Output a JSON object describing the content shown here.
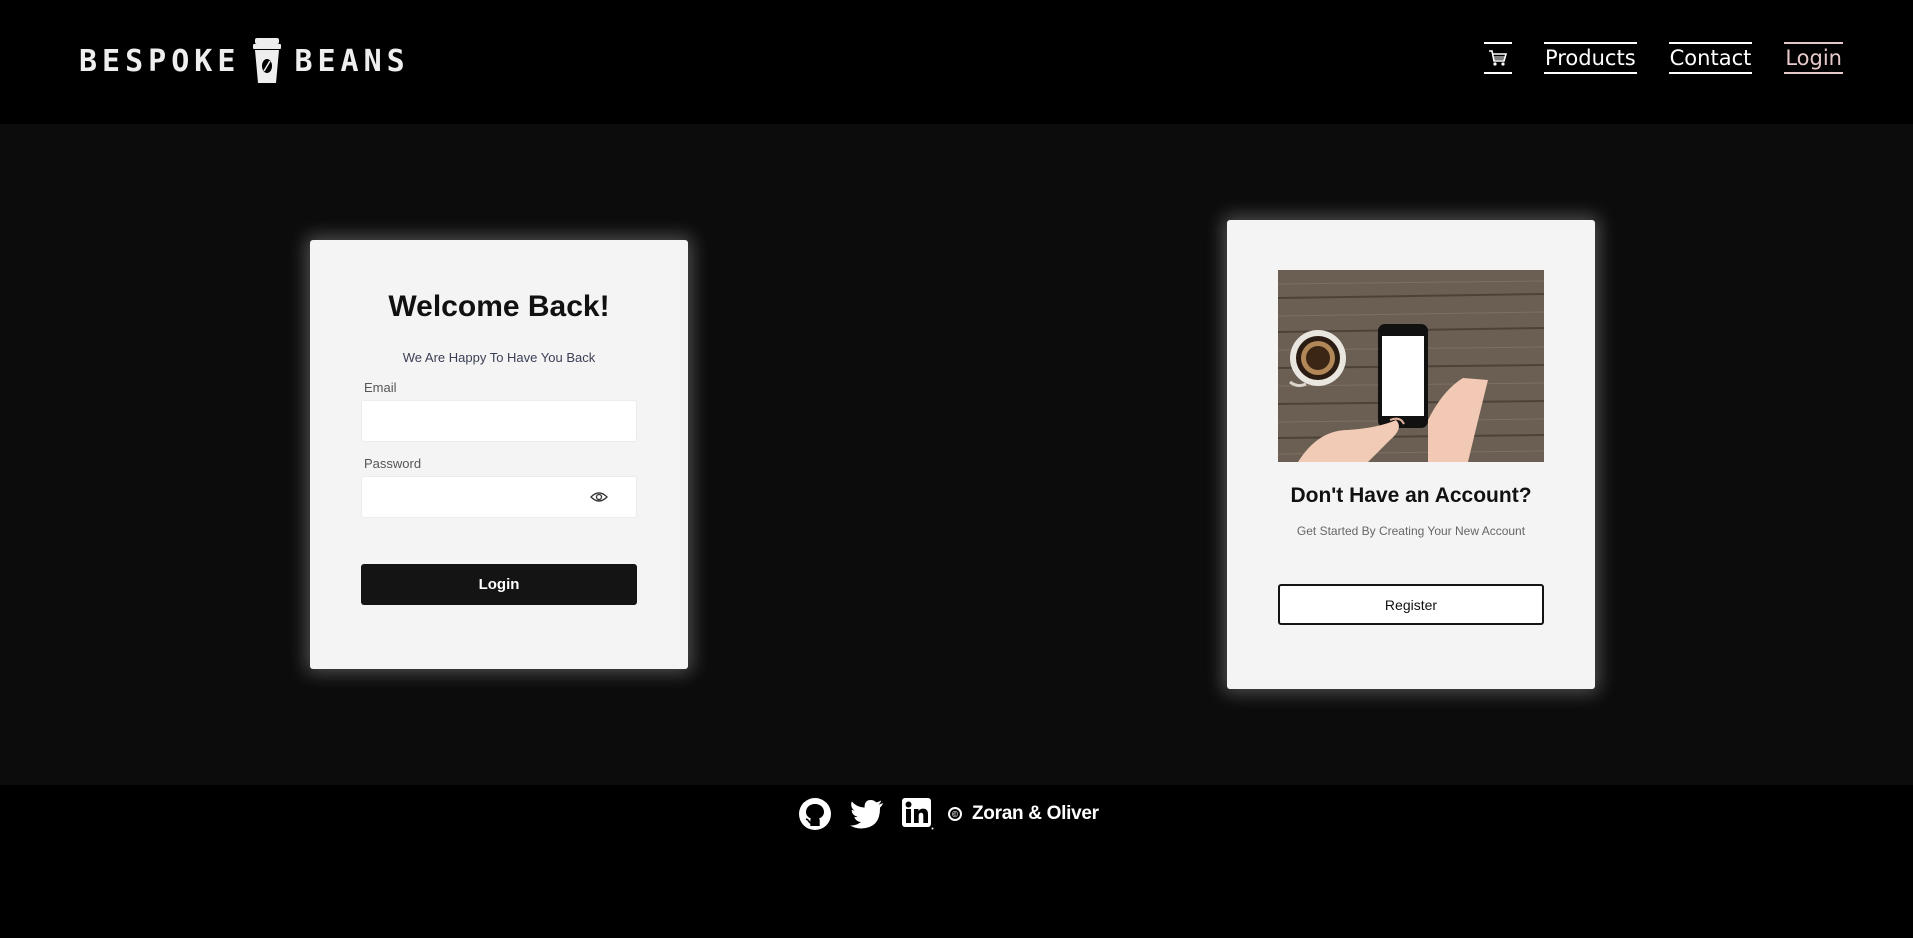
{
  "header": {
    "logo": {
      "word_left": "BESPOKE",
      "word_right": "BEANS"
    },
    "nav": {
      "cart_icon": "cart-icon",
      "items": [
        {
          "label": "Products",
          "active": false
        },
        {
          "label": "Contact",
          "active": false
        },
        {
          "label": "Login",
          "active": true
        }
      ],
      "active_color": "#e8c9c9"
    }
  },
  "login_card": {
    "title": "Welcome Back!",
    "subtitle": "We Are Happy To Have You Back",
    "email_label": "Email",
    "email_value": "",
    "password_label": "Password",
    "password_value": "",
    "password_toggle_icon": "eye-icon",
    "button_label": "Login"
  },
  "register_card": {
    "title": "Don't Have an Account?",
    "subtitle": "Get Started By Creating Your New Account",
    "button_label": "Register"
  },
  "footer": {
    "icons": [
      "github-icon",
      "twitter-icon",
      "linkedin-icon",
      "copyright-icon"
    ],
    "copyright_symbol": "©",
    "credit": "Zoran & Oliver"
  },
  "colors": {
    "page_bg": "#000000",
    "main_bg": "#0c0c0c",
    "card_bg": "#f4f4f4",
    "button_dark": "#141414"
  }
}
